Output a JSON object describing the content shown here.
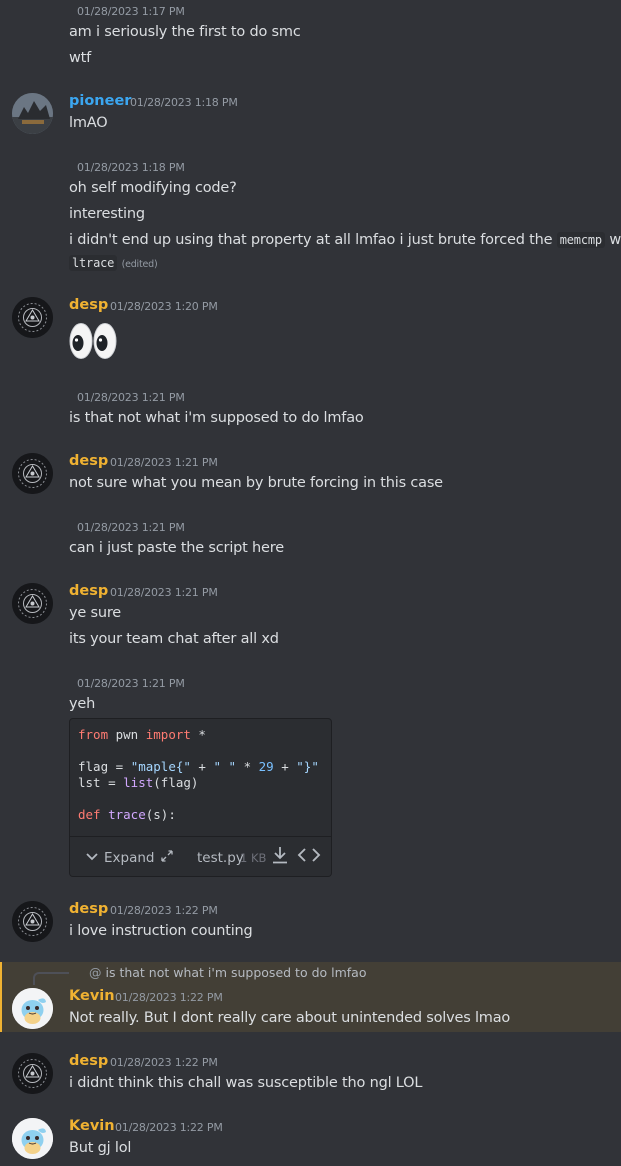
{
  "colors": {
    "background": "#313338",
    "text": "#dbdee1",
    "timestamp": "#949ba4",
    "desp": "#f0b232",
    "pioneer": "#3ba6f0",
    "kevin": "#f0b232",
    "mention_highlight": "#433f36"
  },
  "messages": {
    "m1": {
      "time": "01/28/2023 1:17 PM",
      "line1": "am i seriously the first to do smc",
      "line2": "wtf"
    },
    "m2": {
      "author": "pioneer",
      "time": "01/28/2023 1:18 PM",
      "line1": "lmAO"
    },
    "m3": {
      "time": "01/28/2023 1:18 PM",
      "line1": "oh self modifying code?",
      "line2": "interesting",
      "line3_pre": "i didn't end up using that property at all lmfao i just brute forced the ",
      "line3_code": "memcmp",
      "line3_post": " with",
      "line4_code": "ltrace",
      "edited": "(edited)"
    },
    "m4": {
      "author": "desp",
      "time": "01/28/2023 1:20 PM",
      "emoji": "eyes"
    },
    "m5": {
      "time": "01/28/2023 1:21 PM",
      "line1": "is that not what i'm supposed to do lmfao"
    },
    "m6": {
      "author": "desp",
      "time": "01/28/2023 1:21 PM",
      "line1": "not sure what you mean by brute forcing in this case"
    },
    "m7": {
      "time": "01/28/2023 1:21 PM",
      "line1": "can i just paste the script here"
    },
    "m8": {
      "author": "desp",
      "time": "01/28/2023 1:21 PM",
      "line1": "ye sure",
      "line2": "its your team chat after all xd"
    },
    "m9": {
      "time": "01/28/2023 1:21 PM",
      "line1": "yeh"
    },
    "m10": {
      "author": "desp",
      "time": "01/28/2023 1:22 PM",
      "line1": "i love instruction counting"
    },
    "m11": {
      "reply_prefix": "@",
      "reply_text": "is that not what i'm supposed to do lmfao",
      "author": "Kevin",
      "time": "01/28/2023 1:22 PM",
      "line1": "Not really. But I dont really care about unintended solves lmao"
    },
    "m12": {
      "author": "desp",
      "time": "01/28/2023 1:22 PM",
      "line1": "i didnt think this chall was susceptible tho ngl LOL"
    },
    "m13": {
      "author": "Kevin",
      "time": "01/28/2023 1:22 PM",
      "line1": "But gj lol"
    }
  },
  "attachment": {
    "code": {
      "l1_kw1": "from",
      "l1_mid": " pwn ",
      "l1_kw2": "import",
      "l1_end": " *",
      "l3_pre": "flag = ",
      "l3_s1": "\"maple{\"",
      "l3_mid1": " + ",
      "l3_s2": "\" \"",
      "l3_mid2": " * ",
      "l3_num": "29",
      "l3_mid3": " + ",
      "l3_s3": "\"}\"",
      "l4_pre": "lst = ",
      "l4_fn": "list",
      "l4_post": "(flag)",
      "l6_kw": "def",
      "l6_fn": "trace",
      "l6_post": "(s):"
    },
    "expand_label": "Expand",
    "filename": "test.py",
    "filesize": "1 KB",
    "icons": [
      "chevron-down-icon",
      "expand-arrows-icon",
      "download-icon",
      "code-icon"
    ]
  }
}
